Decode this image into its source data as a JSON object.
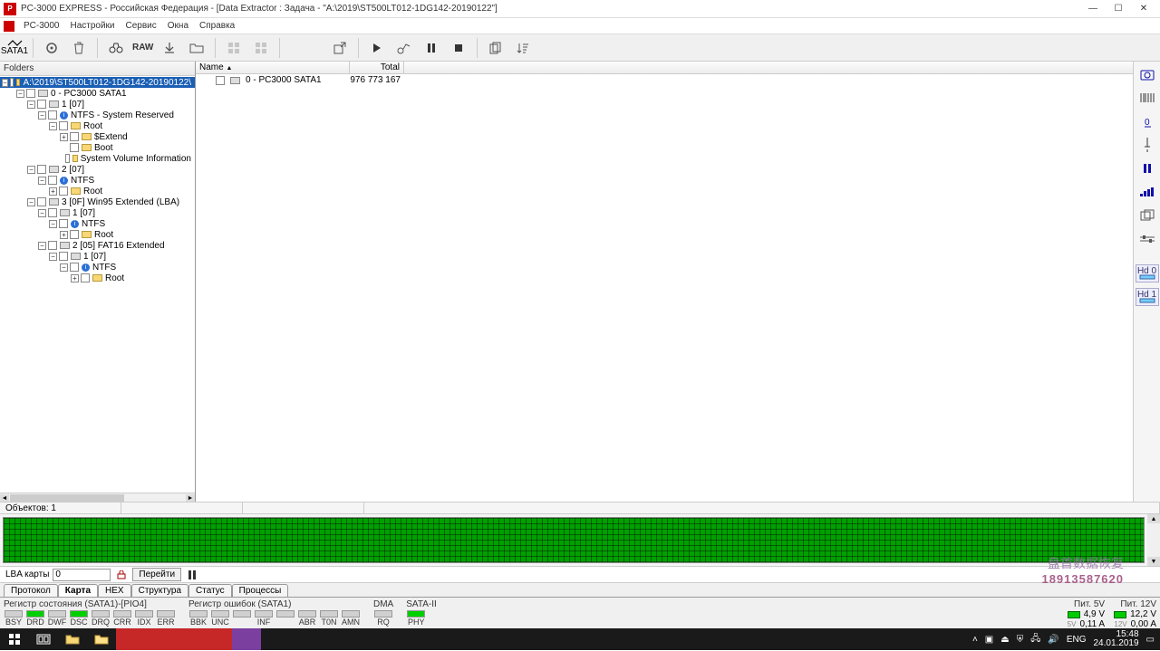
{
  "title": "PC-3000 EXPRESS - Российская Федерация - [Data Extractor : Задача - \"A:\\2019\\ST500LT012-1DG142-20190122\"]",
  "menu": {
    "m1": "PC-3000",
    "m2": "Настройки",
    "m3": "Сервис",
    "m4": "Окна",
    "m5": "Справка"
  },
  "toolbar": {
    "sata": "SATA1",
    "raw": "RAW"
  },
  "folders_hdr": "Folders",
  "tree": {
    "root": "A:\\2019\\ST500LT012-1DG142-20190122\\",
    "n0": "0 - PC3000 SATA1",
    "n1": "1 [07]",
    "n2": "NTFS - System Reserved",
    "n3": "Root",
    "n4": "$Extend",
    "n5": "Boot",
    "n6": "System Volume Information",
    "n7": "2 [07]",
    "n8": "NTFS",
    "n9": "Root",
    "n10": "3 [0F] Win95 Extended  (LBA)",
    "n11": "1 [07]",
    "n12": "NTFS",
    "n13": "Root",
    "n14": "2 [05] FAT16 Extended",
    "n15": "1 [07]",
    "n16": "NTFS",
    "n17": "Root"
  },
  "list": {
    "col_name": "Name",
    "col_total": "Total",
    "row0_name": "0 - PC3000 SATA1",
    "row0_total": "976 773 167"
  },
  "status": {
    "objects": "Объектов: 1"
  },
  "lba": {
    "label": "LBA карты",
    "value": "0",
    "go": "Перейти"
  },
  "watermark": {
    "cn": "盘首数据恢复",
    "ph": "18913587620"
  },
  "tabs": {
    "t1": "Протокол",
    "t2": "Карта",
    "t3": "HEX",
    "t4": "Структура",
    "t5": "Статус",
    "t6": "Процессы"
  },
  "reg": {
    "state_title": "Регистр состояния (SATA1)-[PIO4]",
    "err_title": "Регистр ошибок  (SATA1)",
    "dma": "DMA",
    "sata2": "SATA-II",
    "leds_state": [
      "BSY",
      "DRD",
      "DWF",
      "DSC",
      "DRQ",
      "CRR",
      "IDX",
      "ERR"
    ],
    "leds_err": [
      "BBK",
      "UNC",
      "",
      "INF",
      "",
      "ABR",
      "T0N",
      "AMN"
    ],
    "led_dma": "RQ",
    "led_sata": "PHY",
    "p5": "Пит. 5V",
    "p12": "Пит. 12V",
    "p5v": "4,9 V",
    "p5a": "0,11 A",
    "p12v": "12,2 V",
    "p12a": "0,00 A",
    "pf5": "5V",
    "pf12": "12V"
  },
  "side": {
    "hd0": "Hd 0",
    "hd1": "Hd 1"
  },
  "tray": {
    "lang": "ENG",
    "time": "15:48",
    "date": "24.01.2019"
  }
}
